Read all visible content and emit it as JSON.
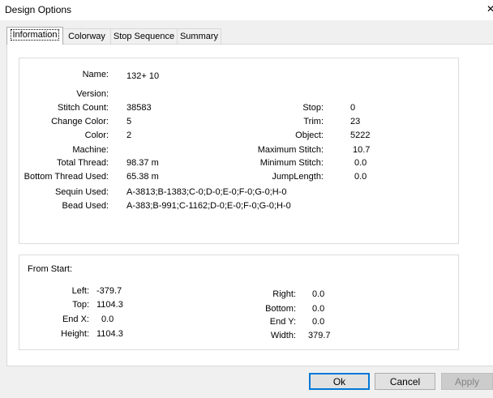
{
  "window": {
    "title": "Design Options",
    "close_glyph": "✕"
  },
  "tabs": [
    {
      "label": "Information",
      "active": true
    },
    {
      "label": "Colorway",
      "active": false
    },
    {
      "label": "Stop Sequence",
      "active": false
    },
    {
      "label": "Summary",
      "active": false
    }
  ],
  "info": {
    "name_label": "Name:",
    "name_value": "132+ 10",
    "version_label": "Version:",
    "version_value": "",
    "stitch_count_label": "Stitch Count:",
    "stitch_count_value": "38583",
    "change_color_label": "Change Color:",
    "change_color_value": "5",
    "color_label": "Color:",
    "color_value": "2",
    "machine_label": "Machine:",
    "machine_value": "",
    "total_thread_label": "Total Thread:",
    "total_thread_value": "98.37 m",
    "bottom_thread_label": "Bottom Thread Used:",
    "bottom_thread_value": "65.38 m",
    "sequin_label": "Sequin Used:",
    "sequin_value": "A-3813;B-1383;C-0;D-0;E-0;F-0;G-0;H-0",
    "bead_label": "Bead Used:",
    "bead_value": "A-383;B-991;C-1162;D-0;E-0;F-0;G-0;H-0",
    "stop_label": "Stop:",
    "stop_value": "0",
    "trim_label": "Trim:",
    "trim_value": "23",
    "object_label": "Object:",
    "object_value": "5222",
    "max_stitch_label": "Maximum Stitch:",
    "max_stitch_value": "10.7",
    "min_stitch_label": "Minimum Stitch:",
    "min_stitch_value": "0.0",
    "jump_length_label": "JumpLength:",
    "jump_length_value": "0.0"
  },
  "from_start": {
    "heading": "From Start:",
    "left_label": "Left:",
    "left_value": "-379.7",
    "top_label": "Top:",
    "top_value": "1104.3",
    "end_x_label": "End X:",
    "end_x_value": "0.0",
    "height_label": "Height:",
    "height_value": "1104.3",
    "right_label": "Right:",
    "right_value": "0.0",
    "bottom_label": "Bottom:",
    "bottom_value": "0.0",
    "end_y_label": "End Y:",
    "end_y_value": "0.0",
    "width_label": "Width:",
    "width_value": "379.7"
  },
  "buttons": {
    "ok_label": "Ok",
    "cancel_label": "Cancel",
    "apply_label": "Apply"
  }
}
